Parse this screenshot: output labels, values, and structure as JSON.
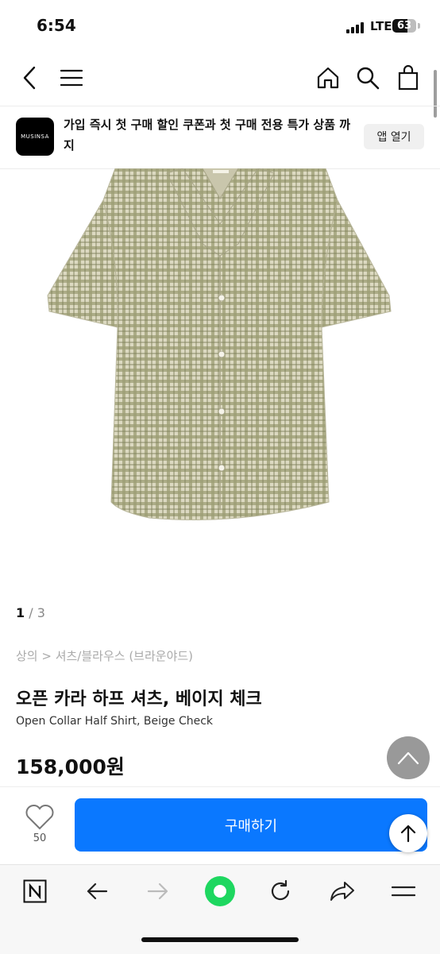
{
  "status_bar": {
    "time": "6:54",
    "network": "LTE",
    "battery": "63"
  },
  "nav": {
    "back_icon": "chevron-left-icon",
    "menu_icon": "hamburger-icon",
    "home_icon": "home-icon",
    "search_icon": "search-icon",
    "cart_icon": "shopping-bag-icon"
  },
  "banner": {
    "logo_text": "MUSINSA",
    "text": "가입 즉시 첫 구매 할인 쿠폰과 첫 구매 전용 특가 상품 까지",
    "open_app_label": "앱 열기"
  },
  "product": {
    "image_pager": {
      "current": "1",
      "total": "/ 3"
    },
    "breadcrumb": "상의 > 셔츠/블라우스 (브라운야드)",
    "title_ko": "오픈 카라 하프 셔츠, 베이지 체크",
    "title_en": "Open Collar Half Shirt, Beige Check",
    "price": "158,000원"
  },
  "purchase_bar": {
    "like_count": "50",
    "buy_label": "구매하기"
  },
  "browser_toolbar": {
    "items": [
      "naver-icon",
      "back-arrow-icon",
      "forward-arrow-icon",
      "green-dot-icon",
      "reload-icon",
      "share-icon",
      "menu-icon"
    ]
  },
  "colors": {
    "accent": "#0a78ff",
    "shirt_base": "#d9d6bd",
    "shirt_check": "#8a8c62",
    "green_dot": "#1ed760"
  }
}
